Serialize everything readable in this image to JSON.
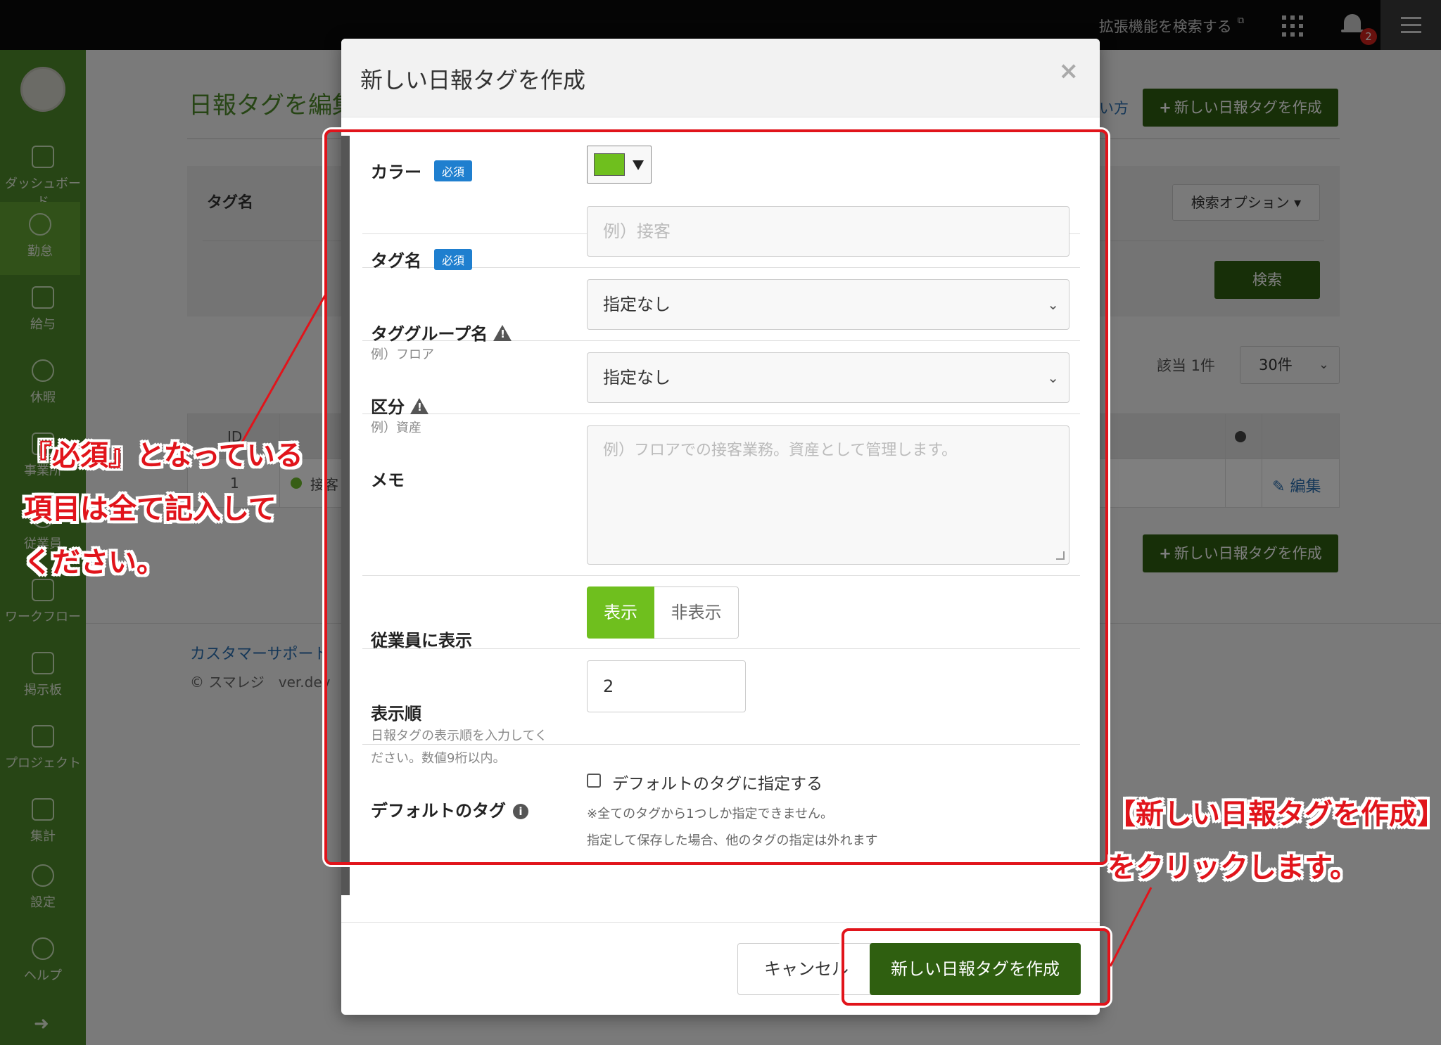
{
  "topbar": {
    "extension_search": "拡張機能を検索する",
    "notification_count": "2"
  },
  "sidebar": {
    "items": [
      {
        "label": "ダッシュボード",
        "icon": "dashboard-icon"
      },
      {
        "label": "勤怠",
        "icon": "clock-icon"
      },
      {
        "label": "給与",
        "icon": "calculator-icon"
      },
      {
        "label": "休暇",
        "icon": "umbrella-icon"
      },
      {
        "label": "事業所",
        "icon": "building-icon"
      },
      {
        "label": "従業員",
        "icon": "user-icon"
      },
      {
        "label": "ワークフロー",
        "icon": "workflow-icon"
      },
      {
        "label": "掲示板",
        "icon": "message-icon"
      },
      {
        "label": "プロジェクト",
        "icon": "flag-icon"
      },
      {
        "label": "集計",
        "icon": "chart-icon"
      },
      {
        "label": "設定",
        "icon": "gear-icon"
      },
      {
        "label": "ヘルプ",
        "icon": "help-icon"
      }
    ]
  },
  "page": {
    "title": "日報タグを編集",
    "howto": "い方",
    "new_tag_button": "新しい日報タグを作成",
    "search_tagname_label": "タグ名",
    "search_options": "検索オプション",
    "search_button": "検索",
    "count": "該当 1件",
    "per_page": "30件",
    "table": {
      "header_id": "ID",
      "row_id": "1",
      "row_name": "接客",
      "edit": "編集"
    },
    "support": "カスタマーサポート",
    "copyright": "© スマレジ　ver.dev"
  },
  "modal": {
    "title": "新しい日報タグを作成",
    "close": "×",
    "required_badge": "必須",
    "fields": {
      "color": {
        "label": "カラー",
        "value": "#6fbf1e"
      },
      "tag_name": {
        "label": "タグ名",
        "placeholder": "例）接客"
      },
      "tag_group": {
        "label": "タググループ名",
        "sub": "例）フロア",
        "value": "指定なし"
      },
      "category": {
        "label": "区分",
        "sub": "例）資産",
        "value": "指定なし"
      },
      "memo": {
        "label": "メモ",
        "placeholder": "例）フロアでの接客業務。資産として管理します。"
      },
      "show_to_employees": {
        "label": "従業員に表示",
        "on": "表示",
        "off": "非表示",
        "selected": "表示"
      },
      "display_order": {
        "label": "表示順",
        "sub_line1": "日報タグの表示順を入力してく",
        "sub_line2": "ださい。数値9桁以内。",
        "value": "2"
      },
      "default_tag": {
        "label": "デフォルトのタグ",
        "checkbox_label": "デフォルトのタグに指定する",
        "note1": "※全てのタグから1つしか指定できません。",
        "note2": "指定して保存した場合、他のタグの指定は外れます",
        "checked": false
      }
    },
    "cancel": "キャンセル",
    "submit": "新しい日報タグを作成"
  },
  "annotations": {
    "left_line1": "『必須』となっている",
    "left_line2": "項目は全て記入して",
    "left_line3": "ください。",
    "right_line1": "【新しい日報タグを作成】",
    "right_line2": "をクリックします。",
    "color": "#e1141b"
  }
}
